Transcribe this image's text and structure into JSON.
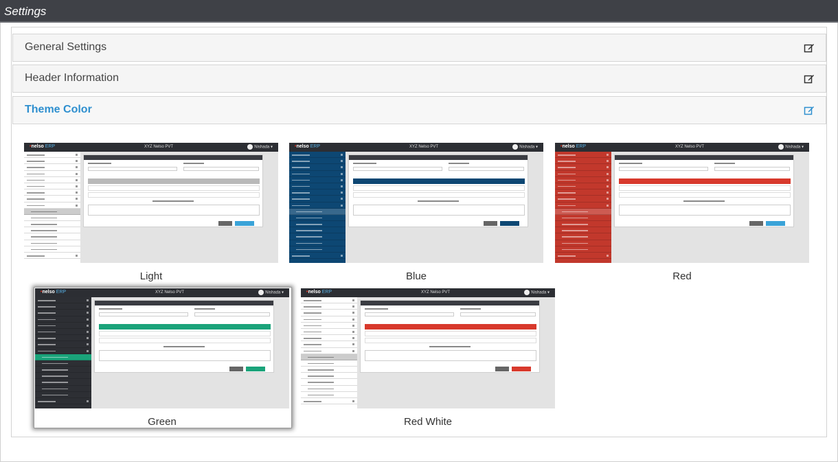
{
  "window": {
    "title": "Settings"
  },
  "panels": [
    {
      "title": "General Settings",
      "icon": "edit-icon",
      "active": false
    },
    {
      "title": "Header Information",
      "icon": "edit-icon",
      "active": false
    },
    {
      "title": "Theme Color",
      "icon": "edit-icon",
      "active": true
    }
  ],
  "themes": [
    {
      "label": "Light",
      "sidebar": "#ffffff",
      "sidebar_text": "#333333",
      "accent": "#b9b9b9",
      "button": "#3aa3d8",
      "selected": false
    },
    {
      "label": "Blue",
      "sidebar": "#0d4773",
      "sidebar_text": "#ffffff",
      "accent": "#0d4773",
      "button": "#0d4773",
      "selected": false
    },
    {
      "label": "Red",
      "sidebar": "#c2382c",
      "sidebar_text": "#ffffff",
      "accent": "#d8392c",
      "button": "#3aa3d8",
      "selected": false
    },
    {
      "label": "Green",
      "sidebar": "#2d2f34",
      "sidebar_text": "#ffffff",
      "accent": "#1aa37a",
      "button": "#1aa37a",
      "selected": true
    },
    {
      "label": "Red White",
      "sidebar": "#ffffff",
      "sidebar_text": "#333333",
      "accent": "#d8392c",
      "button": "#d8392c",
      "selected": false
    }
  ],
  "preview": {
    "logo_prefix": "nelso",
    "logo_suffix": "ERP",
    "app_title": "XYZ Nelso PVT",
    "user": "Nishada"
  },
  "colors": {
    "titlebar": "#3f4147",
    "active_panel_title": "#2e8fcf"
  }
}
